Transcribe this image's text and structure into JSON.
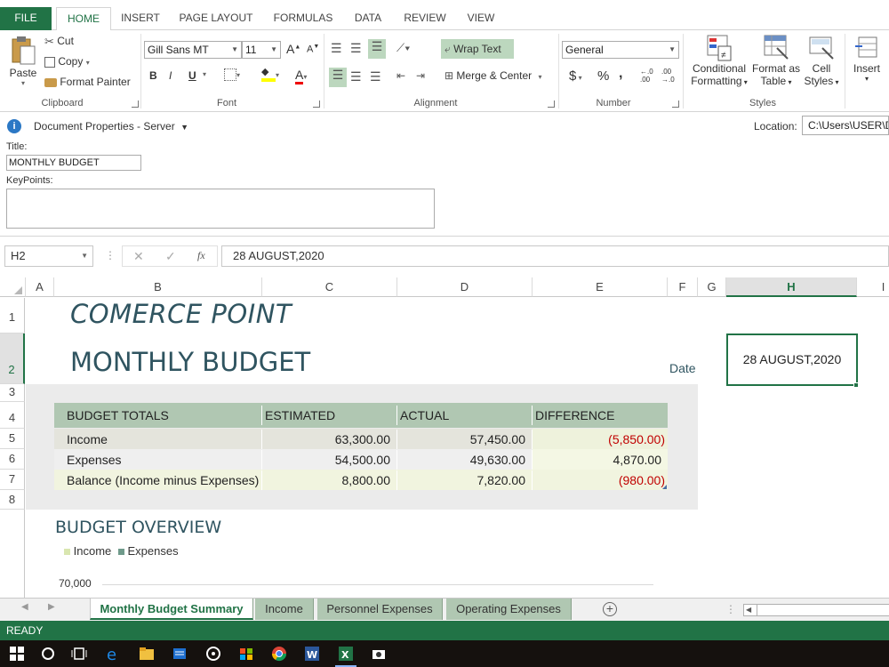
{
  "ribbon": {
    "tabs": [
      "FILE",
      "HOME",
      "INSERT",
      "PAGE LAYOUT",
      "FORMULAS",
      "DATA",
      "REVIEW",
      "VIEW"
    ],
    "clipboard": {
      "paste": "Paste",
      "cut": "Cut",
      "copy": "Copy",
      "format_painter": "Format Painter",
      "label": "Clipboard"
    },
    "font": {
      "name": "Gill Sans MT",
      "size": "11",
      "bold": "B",
      "italic": "I",
      "underline": "U",
      "grow": "A",
      "shrink": "A",
      "font_color": "A",
      "label": "Font"
    },
    "alignment": {
      "wrap_text": "Wrap Text",
      "merge_center": "Merge & Center",
      "label": "Alignment"
    },
    "number": {
      "format": "General",
      "currency": "$",
      "percent": "%",
      "comma": ",",
      "label": "Number"
    },
    "styles": {
      "conditional_formatting": "Conditional",
      "conditional_formatting2": "Formatting",
      "format_as_table": "Format as",
      "format_as_table2": "Table",
      "cell_styles": "Cell",
      "cell_styles2": "Styles",
      "label": "Styles"
    },
    "cells": {
      "insert": "Insert"
    }
  },
  "doc_props": {
    "header": "Document Properties - Server",
    "location_label": "Location:",
    "location_value": "C:\\Users\\USER\\De",
    "title_label": "Title:",
    "title_value": "MONTHLY BUDGET",
    "keypoints_label": "KeyPoints:",
    "keypoints_value": ""
  },
  "formula_bar": {
    "name_box": "H2",
    "fx": "fx",
    "formula": "28 AUGUST,2020"
  },
  "sheet": {
    "columns": [
      "A",
      "B",
      "C",
      "D",
      "E",
      "F",
      "G",
      "H",
      "I"
    ],
    "rows": [
      "1",
      "2",
      "3",
      "4",
      "5",
      "6",
      "7",
      "8"
    ],
    "company": "COMERCE POINT",
    "title": "MONTHLY BUDGET",
    "date_label": "Date",
    "date_value": "28 AUGUST,2020",
    "table_headers": [
      "BUDGET TOTALS",
      "ESTIMATED",
      "ACTUAL",
      "DIFFERENCE"
    ],
    "table_rows": [
      {
        "label": "Income",
        "estimated": "63,300.00",
        "actual": "57,450.00",
        "difference": "(5,850.00)"
      },
      {
        "label": "Expenses",
        "estimated": "54,500.00",
        "actual": "49,630.00",
        "difference": "4,870.00"
      },
      {
        "label": "Balance (Income minus Expenses)",
        "estimated": "8,800.00",
        "actual": "7,820.00",
        "difference": "(980.00)"
      }
    ],
    "overview_title": "BUDGET OVERVIEW",
    "legend": [
      "Income",
      "Expenses"
    ],
    "axis_tick": "70,000"
  },
  "sheet_tabs": [
    "Monthly Budget Summary",
    "Income",
    "Personnel Expenses",
    "Operating Expenses"
  ],
  "status": "READY",
  "colors": {
    "accent": "#217346",
    "header_fill": "#b0c7b2",
    "neg": "#c00000",
    "title": "#2f5460"
  }
}
